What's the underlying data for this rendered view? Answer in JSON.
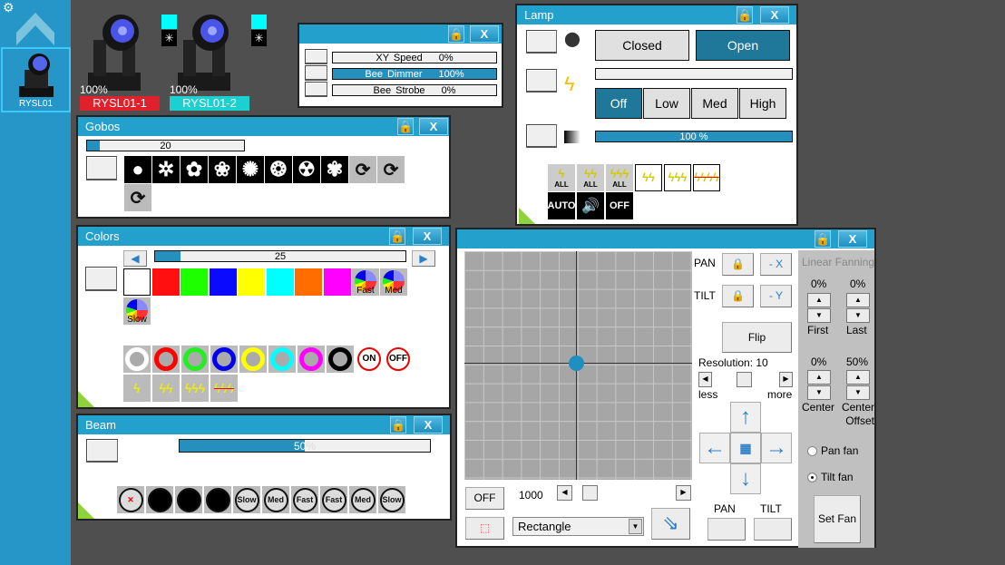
{
  "sidebar": {
    "group_label": "RYSL01"
  },
  "fixtures": [
    {
      "level": "100%",
      "name": "RYSL01-1",
      "color": "#e0202a"
    },
    {
      "level": "100%",
      "name": "RYSL01-2",
      "color": "#1ccfd0"
    }
  ],
  "speed_window": {
    "rows": [
      {
        "label": "XY Speed",
        "value": "0%",
        "fill": 0
      },
      {
        "label": "Bee Dimmer",
        "value": "100%",
        "fill": 100
      },
      {
        "label": "Bee Strobe",
        "value": "0%",
        "fill": 0
      }
    ]
  },
  "gobos": {
    "title": "Gobos",
    "value": "20",
    "fill": 8,
    "items": [
      "●",
      "✲",
      "✿",
      "❀",
      "✺",
      "❂",
      "☢",
      "✾",
      "⟳",
      "⟳",
      "⟳"
    ]
  },
  "colors": {
    "title": "Colors",
    "value": "25",
    "fill": 10,
    "swatches": [
      "#ffffff",
      "#ff0f0f",
      "#1eff00",
      "#0a0aff",
      "#ffff00",
      "#00ffff",
      "#ff6c00",
      "#ff00ff"
    ],
    "rainbow": [
      "Fast",
      "Med",
      "Slow"
    ],
    "rings": [
      "#ffffff",
      "#ff0000",
      "#22ee22",
      "#0000ee",
      "#ffff00",
      "#00ffff",
      "#ff00ff",
      "#000000"
    ],
    "onoff": [
      "ON",
      "OFF"
    ],
    "strobe": [
      "ϟ",
      "ϟϟ",
      "ϟϟϟ",
      "ϟϟϟ"
    ]
  },
  "beam": {
    "title": "Beam",
    "value": "50",
    "unit": "%",
    "fill": 50,
    "items": [
      "✕",
      "",
      "",
      "",
      "Slow",
      "Med",
      "Fast",
      "Fast",
      "Med",
      "Slow"
    ]
  },
  "lamp": {
    "title": "Lamp",
    "closed": "Closed",
    "open": "Open",
    "strobe_modes": [
      "Off",
      "Low",
      "Med",
      "High"
    ],
    "dimmer": "100 %",
    "dimmer_fill": 100,
    "strobe_icons": [
      "ALL",
      "ALL",
      "ALL",
      "",
      "",
      ""
    ],
    "extras": [
      "AUTO",
      "🔊",
      "OFF"
    ]
  },
  "position": {
    "pan": "PAN",
    "tilt": "TILT",
    "minus_x": "- X",
    "minus_y": "- Y",
    "flip": "Flip",
    "resolution": "Resolution: 10",
    "less": "less",
    "more": "more",
    "off": "OFF",
    "speed": "1000",
    "shape": "Rectangle",
    "pan_bottom": "PAN",
    "tilt_bottom": "TILT",
    "fanning": {
      "title": "Linear Fanning",
      "first": "0%",
      "last": "0%",
      "center": "0%",
      "offset": "50%",
      "first_label": "First",
      "last_label": "Last",
      "center_label": "Center",
      "offset_label": "Center Offset",
      "pan_fan": "Pan fan",
      "tilt_fan": "Tilt fan",
      "set_fan": "Set Fan",
      "selected": "tilt"
    }
  }
}
